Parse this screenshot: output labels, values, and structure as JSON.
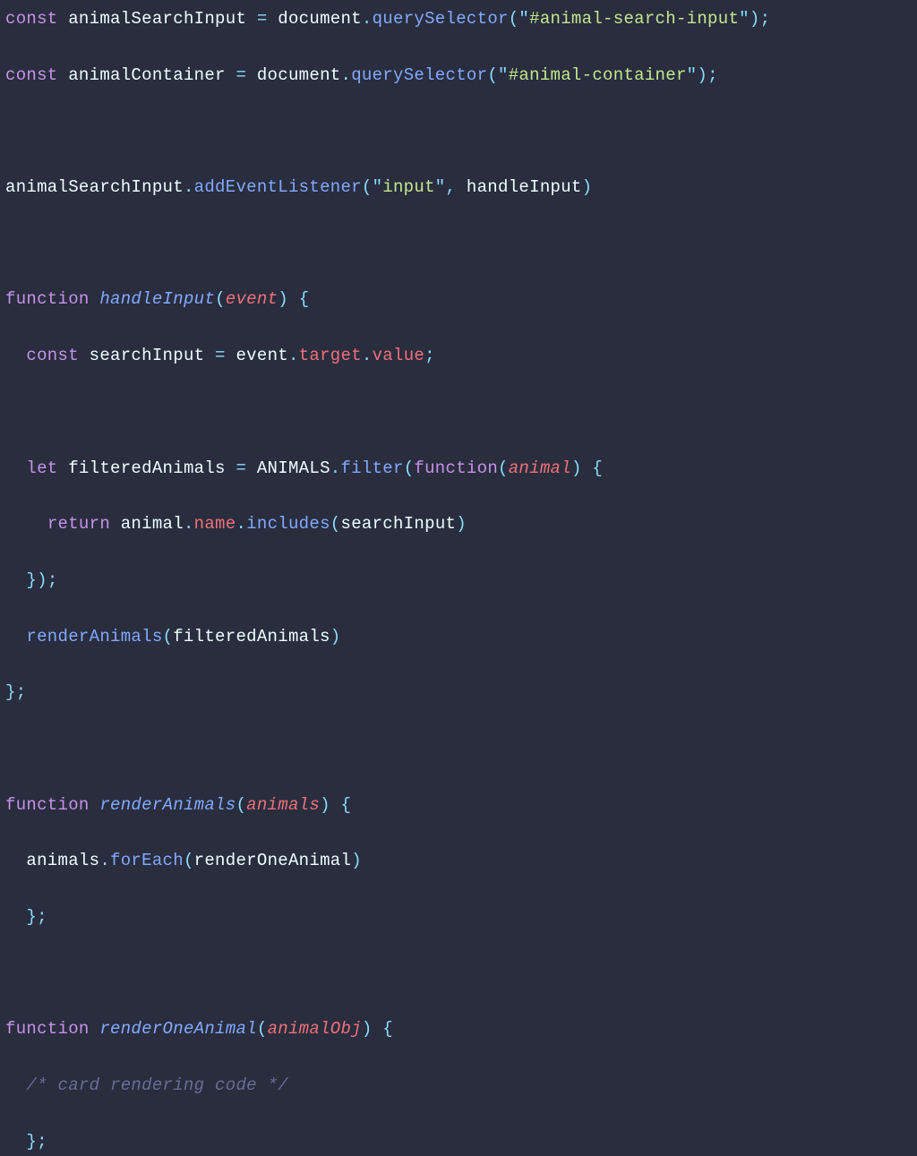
{
  "tokens": {
    "const": "const",
    "let": "let",
    "function": "function",
    "return": "return",
    "animalSearchInput": "animalSearchInput",
    "animalContainer": "animalContainer",
    "document": "document",
    "querySelector": "querySelector",
    "addEventListener": "addEventListener",
    "handleInput": "handleInput",
    "event": "event",
    "searchInput": "searchInput",
    "target": "target",
    "value": "value",
    "filteredAnimals": "filteredAnimals",
    "ANIMALS": "ANIMALS",
    "filter": "filter",
    "animal": "animal",
    "name": "name",
    "includes": "includes",
    "renderAnimals": "renderAnimals",
    "animals": "animals",
    "forEach": "forEach",
    "renderOneAnimal": "renderOneAnimal",
    "animalObj": "animalObj",
    "str_input": "input",
    "str_searchInputSel": "#animal-search-input",
    "str_containerSel": "#animal-container",
    "comment_cardRender": "/* card rendering code */",
    "eq": " = ",
    "dot": ".",
    "lp": "(",
    "rp": ")",
    "lb": "{",
    "rb": "}",
    "semi": ";",
    "comma": ", ",
    "dq": "\"",
    "sp": " "
  }
}
